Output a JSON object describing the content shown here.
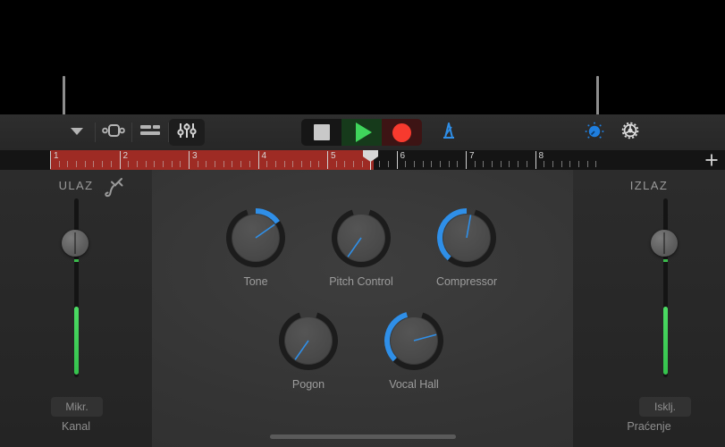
{
  "app": {
    "title": "GarageBand Recording View",
    "accent_blue": "#2f8fe8",
    "record_red": "#f73a2e",
    "play_green": "#3fd45b",
    "cycle_red": "#9e2b24",
    "meter_green": "#4cdc64"
  },
  "annotations": [
    {
      "name": "pointer-line-input",
      "target": "input-section"
    },
    {
      "name": "pointer-line-smart-controls",
      "target": "smart-controls-button"
    }
  ],
  "toolbar": {
    "left_buttons": [
      {
        "name": "navigation-chevron",
        "icon": "chevron-down-icon",
        "label": "Navigation"
      },
      {
        "name": "cycle-button",
        "icon": "cycle-icon",
        "label": "Cycle"
      },
      {
        "name": "tracks-button",
        "icon": "tracks-list-icon",
        "label": "Tracks"
      },
      {
        "name": "mixer-button",
        "icon": "mixer-faders-icon",
        "label": "Mixer",
        "active": true
      }
    ],
    "transport": [
      {
        "name": "stop-button",
        "icon": "stop-icon",
        "label": "Stop"
      },
      {
        "name": "play-button",
        "icon": "play-icon",
        "label": "Play"
      },
      {
        "name": "record-button",
        "icon": "record-icon",
        "label": "Record"
      }
    ],
    "metronome": {
      "name": "metronome-button",
      "icon": "metronome-icon",
      "label": "Metronome"
    },
    "right_buttons": [
      {
        "name": "smart-controls-button",
        "icon": "knob-icon",
        "label": "Smart Controls",
        "active": true
      },
      {
        "name": "settings-button",
        "icon": "gear-icon",
        "label": "Settings"
      }
    ]
  },
  "ruler": {
    "bars": [
      "1",
      "2",
      "3",
      "4",
      "5",
      "6",
      "7",
      "8"
    ],
    "cycle_start_bar": 1,
    "cycle_end_bar": 4.7,
    "playhead_bar": 4.7,
    "add_label": "+"
  },
  "input": {
    "title": "ULAZ",
    "icon": "audio-plug-icon",
    "fader_value_label": "",
    "channel_button": "Mikr.",
    "channel_label": "Kanal"
  },
  "output": {
    "title": "IZLAZ",
    "monitor_button": "Isklj.",
    "monitor_label": "Praćenje"
  },
  "knobs": [
    {
      "name": "knob-tone",
      "label": "Tone",
      "angle": 55,
      "arc_from": 0,
      "arc_to": 55,
      "has_arc": true
    },
    {
      "name": "knob-pitch",
      "label": "Pitch Control",
      "angle": 215,
      "arc_from": 0,
      "arc_to": 0,
      "has_arc": false
    },
    {
      "name": "knob-compressor",
      "label": "Compressor",
      "angle": 10,
      "arc_from": 220,
      "arc_to": 360,
      "has_arc": true
    },
    {
      "name": "knob-drive",
      "label": "Pogon",
      "angle": 215,
      "arc_from": 0,
      "arc_to": 0,
      "has_arc": false
    },
    {
      "name": "knob-vocalhall",
      "label": "Vocal Hall",
      "angle": 75,
      "arc_from": 225,
      "arc_to": 345,
      "has_arc": true
    }
  ],
  "system": {
    "home_indicator": "home-indicator"
  }
}
